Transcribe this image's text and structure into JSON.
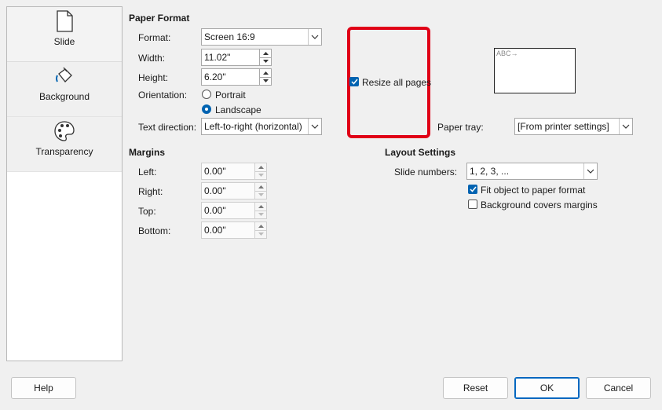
{
  "nav": {
    "items": [
      {
        "label": "Slide",
        "icon": "slide-page-icon"
      },
      {
        "label": "Background",
        "icon": "paint-bucket-icon"
      },
      {
        "label": "Transparency",
        "icon": "palette-icon"
      }
    ]
  },
  "paper_format": {
    "title": "Paper Format",
    "format_label": "Format:",
    "format_value": "Screen 16:9",
    "width_label": "Width:",
    "width_value": "11.02\"",
    "height_label": "Height:",
    "height_value": "6.20\"",
    "orientation_label": "Orientation:",
    "portrait_label": "Portrait",
    "landscape_label": "Landscape",
    "orientation_selected": "Landscape",
    "text_direction_label": "Text direction:",
    "text_direction_value": "Left-to-right (horizontal)",
    "resize_all_label": "Resize all pages",
    "resize_all_checked": true,
    "paper_tray_label": "Paper tray:",
    "paper_tray_value": "[From printer settings]",
    "preview_text": "ABC→"
  },
  "margins": {
    "title": "Margins",
    "left_label": "Left:",
    "left_value": "0.00\"",
    "right_label": "Right:",
    "right_value": "0.00\"",
    "top_label": "Top:",
    "top_value": "0.00\"",
    "bottom_label": "Bottom:",
    "bottom_value": "0.00\""
  },
  "layout": {
    "title": "Layout Settings",
    "slide_numbers_label": "Slide numbers:",
    "slide_numbers_value": "1, 2, 3, ...",
    "fit_object_label": "Fit object to paper format",
    "fit_object_checked": true,
    "bg_margins_label": "Background covers margins",
    "bg_margins_checked": false
  },
  "footer": {
    "help": "Help",
    "reset": "Reset",
    "ok": "OK",
    "cancel": "Cancel"
  },
  "colors": {
    "accent": "#0063b1",
    "highlight": "#e00016"
  }
}
